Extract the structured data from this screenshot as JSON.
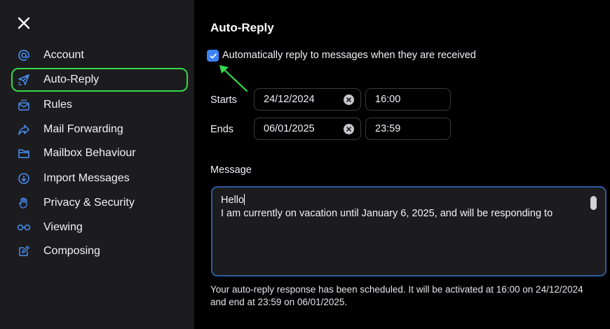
{
  "sidebar": {
    "close_icon": "close-icon",
    "items": [
      {
        "label": "Account",
        "icon": "at-sign-icon"
      },
      {
        "label": "Auto-Reply",
        "icon": "paper-plane-icon",
        "active": true
      },
      {
        "label": "Rules",
        "icon": "mail-rules-icon"
      },
      {
        "label": "Mail Forwarding",
        "icon": "forward-icon"
      },
      {
        "label": "Mailbox Behaviour",
        "icon": "folder-icon"
      },
      {
        "label": "Import Messages",
        "icon": "download-icon"
      },
      {
        "label": "Privacy & Security",
        "icon": "hand-icon"
      },
      {
        "label": "Viewing",
        "icon": "glasses-icon"
      },
      {
        "label": "Composing",
        "icon": "compose-icon"
      }
    ]
  },
  "main": {
    "title": "Auto-Reply",
    "auto_reply_enabled": true,
    "checkbox_label": "Automatically reply to messages when they are received",
    "starts": {
      "label": "Starts",
      "date": "24/12/2024",
      "time": "16:00"
    },
    "ends": {
      "label": "Ends",
      "date": "06/01/2025",
      "time": "23:59"
    },
    "message_label": "Message",
    "message_lines": [
      "Hello",
      "I am currently on vacation until January 6, 2025, and will be responding to"
    ],
    "info_text": "Your auto-reply response has been scheduled. It will be activated at 16:00 on 24/12/2024 and end at 23:59 on 06/01/2025."
  },
  "colors": {
    "sidebar_bg": "#1c1c1e",
    "accent_blue": "#3b82f6",
    "icon_blue": "#4a8ff7",
    "highlight_green": "#35d94a"
  }
}
